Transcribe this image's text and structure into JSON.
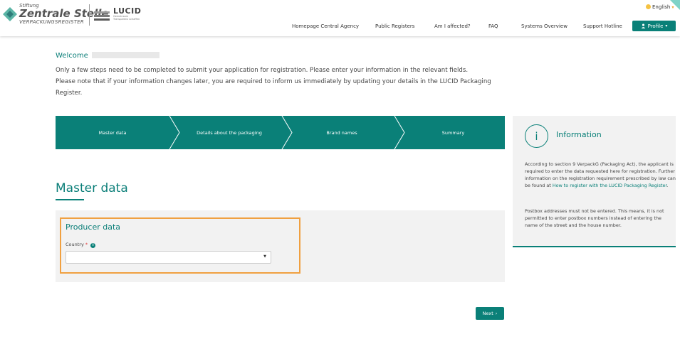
{
  "brand": {
    "stiftung": "Stiftung",
    "zentrale": "Zentrale Stelle",
    "register": "VERPACKUNGSREGISTER",
    "lucid_name": "LUCID",
    "lucid_tagline_1": "Gemeinsam",
    "lucid_tagline_2": "Transparenz schaffen"
  },
  "nav": {
    "items": [
      {
        "label": "Homepage Central Agency"
      },
      {
        "label": "Public Registers"
      },
      {
        "label": "Am I affected?"
      },
      {
        "label": "FAQ"
      },
      {
        "label": "Systems Overview"
      },
      {
        "label": "Support Hotline"
      }
    ],
    "profile_label": "Profile",
    "language": "English"
  },
  "welcome": {
    "greeting": "Welcome",
    "intro_line1": "Only a few steps need to be completed to submit your application for registration. Please enter your information in the relevant fields.",
    "intro_line2": "Please note that if your information changes later, you are required to inform us immediately by updating your details in the LUCID Packaging Register."
  },
  "stepper": {
    "steps": [
      {
        "label": "Master data"
      },
      {
        "label": "Details about the packaging"
      },
      {
        "label": "Brand names"
      },
      {
        "label": "Summary"
      }
    ],
    "active_index": 0
  },
  "info_panel": {
    "icon": "i",
    "title": "Information",
    "para1_text": "According to section 9 VerpackG (Packaging Act), the applicant is required to enter the data requested here for registration. Further information on the registration requirement prescribed by law can be found at ",
    "para1_link": "How to register with the LUCID Packaging Register",
    "para1_end": ".",
    "para2": "Postbox addresses must not be entered. This means, it is not permitted to enter postbox numbers instead of entering the name of the street and the house number."
  },
  "section": {
    "title": "Master data",
    "group_title": "Producer data",
    "country_label": "Country",
    "required_mark": "*",
    "country_value": ""
  },
  "actions": {
    "next_label": "Next"
  },
  "colors": {
    "accent": "#0a8078",
    "highlight": "#f0a040",
    "panel": "#f2f2f2"
  }
}
